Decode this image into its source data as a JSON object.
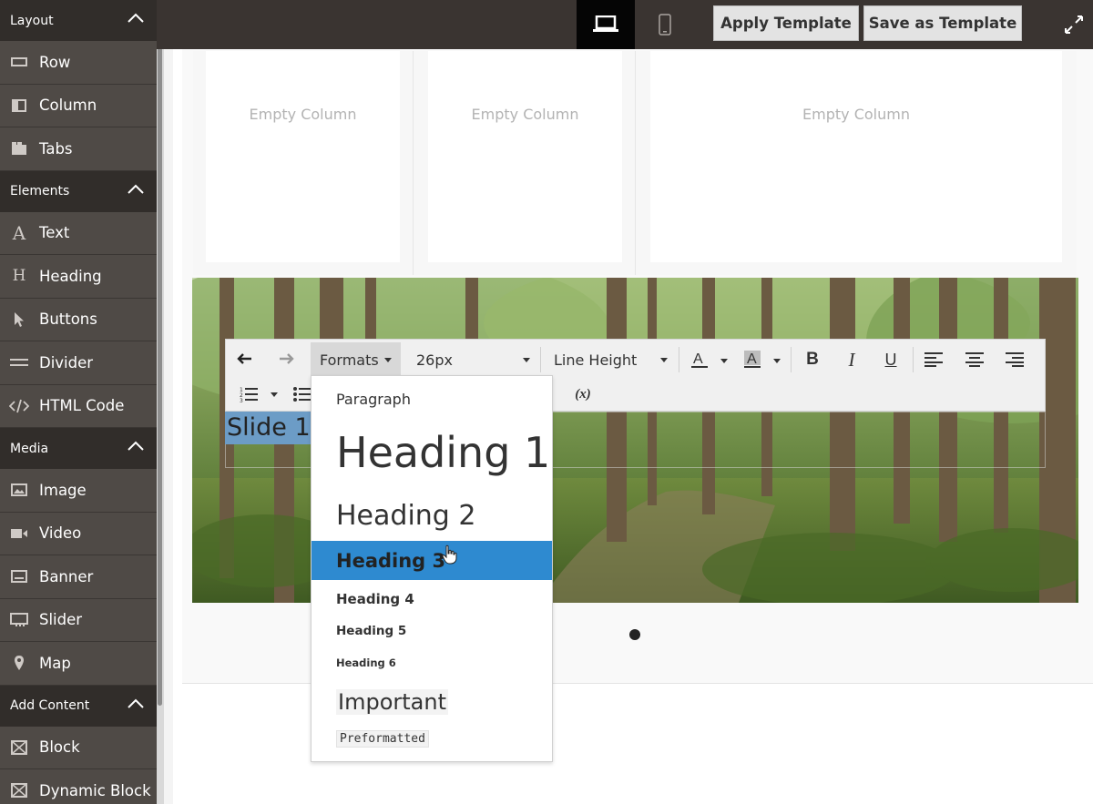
{
  "sidebar": {
    "sections": [
      {
        "title": "Layout",
        "items": [
          {
            "label": "Row",
            "icon": "row-icon"
          },
          {
            "label": "Column",
            "icon": "column-icon"
          },
          {
            "label": "Tabs",
            "icon": "tabs-icon"
          }
        ]
      },
      {
        "title": "Elements",
        "items": [
          {
            "label": "Text",
            "icon": "text-icon"
          },
          {
            "label": "Heading",
            "icon": "heading-icon"
          },
          {
            "label": "Buttons",
            "icon": "cursor-icon"
          },
          {
            "label": "Divider",
            "icon": "divider-icon"
          },
          {
            "label": "HTML Code",
            "icon": "code-icon"
          }
        ]
      },
      {
        "title": "Media",
        "items": [
          {
            "label": "Image",
            "icon": "image-icon"
          },
          {
            "label": "Video",
            "icon": "video-icon"
          },
          {
            "label": "Banner",
            "icon": "banner-icon"
          },
          {
            "label": "Slider",
            "icon": "slider-icon"
          },
          {
            "label": "Map",
            "icon": "map-pin-icon"
          }
        ]
      },
      {
        "title": "Add Content",
        "items": [
          {
            "label": "Block",
            "icon": "block-icon"
          },
          {
            "label": "Dynamic Block",
            "icon": "dynamic-block-icon"
          }
        ]
      }
    ]
  },
  "topbar": {
    "apply_template": "Apply Template",
    "save_template": "Save as Template"
  },
  "stage": {
    "columns": [
      "Empty Column",
      "Empty Column",
      "Empty Column"
    ],
    "slide_text": "Slide 1"
  },
  "toolbar": {
    "formats": "Formats",
    "font_size": "26px",
    "line_height": "Line Height",
    "variable": "(x)"
  },
  "formats_menu": {
    "items": [
      "Paragraph",
      "Heading 1",
      "Heading 2",
      "Heading 3",
      "Heading 4",
      "Heading 5",
      "Heading 6",
      "Important",
      "Preformatted"
    ],
    "selected": "Heading 3",
    "highlight_color": "#2e8ad0"
  },
  "colors": {
    "sidebar_bg": "#4f4a46",
    "sidebar_header": "#312d2a",
    "topbar_bg": "#3a3431",
    "active_device": "#050505"
  }
}
